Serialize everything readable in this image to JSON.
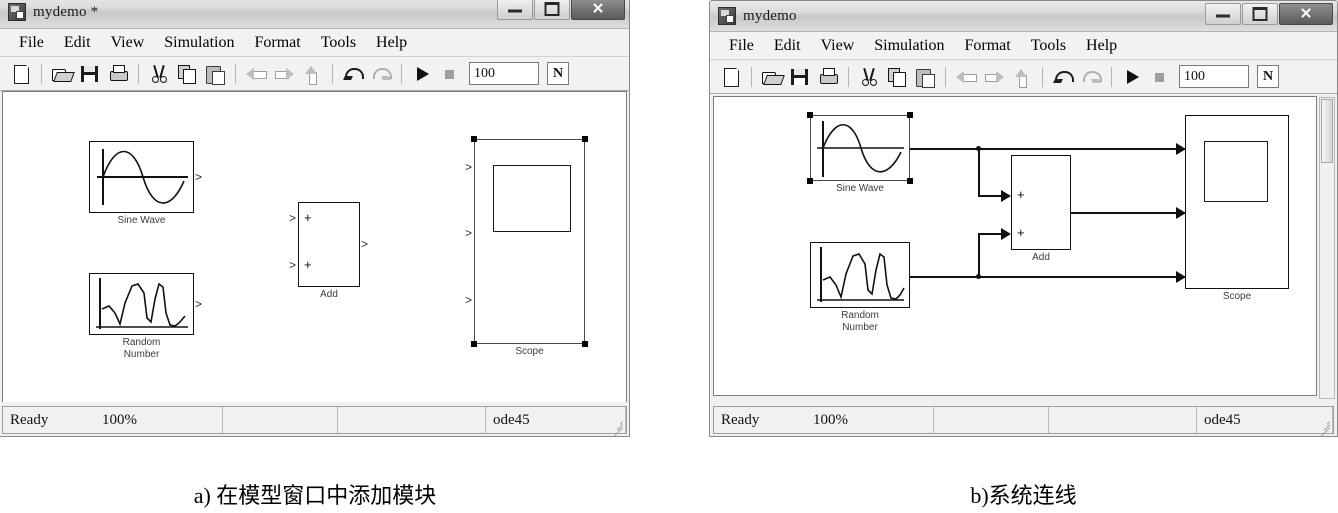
{
  "figure": {
    "caption_a": "a) 在模型窗口中添加模块",
    "caption_b": "b)系统连线"
  },
  "window_a": {
    "title": "mydemo *",
    "app_icon": "simulink-model-icon",
    "caption_buttons": {
      "minimize": "minimize-icon",
      "maximize": "maximize-icon",
      "close": "✕"
    },
    "menubar": [
      "File",
      "Edit",
      "View",
      "Simulation",
      "Format",
      "Tools",
      "Help"
    ],
    "toolbar": {
      "icons": [
        "new-model-icon",
        "open-model-icon",
        "save-icon",
        "print-icon",
        "cut-icon",
        "copy-icon",
        "paste-icon",
        "back-icon",
        "forward-icon",
        "up-level-icon",
        "undo-icon",
        "redo-icon",
        "start-simulation-icon",
        "stop-simulation-icon"
      ],
      "stop_time_value": "100",
      "sim_mode_value": "N"
    },
    "blocks": [
      {
        "name": "Sine Wave",
        "label": "Sine Wave",
        "type": "source-sine"
      },
      {
        "name": "Random Number",
        "label": "Random\nNumber",
        "type": "source-random"
      },
      {
        "name": "Add",
        "label": "Add",
        "type": "math-add",
        "signs": [
          "+",
          "+"
        ]
      },
      {
        "name": "Scope",
        "label": "Scope",
        "type": "sink-scope",
        "selected": true,
        "inputs": 3
      }
    ],
    "statusbar": {
      "state": "Ready",
      "zoom": "100%",
      "field3": "",
      "field4": "",
      "solver": "ode45"
    }
  },
  "window_b": {
    "title": "mydemo",
    "app_icon": "simulink-model-icon",
    "caption_buttons": {
      "minimize": "minimize-icon",
      "maximize": "maximize-icon",
      "close": "✕"
    },
    "menubar": [
      "File",
      "Edit",
      "View",
      "Simulation",
      "Format",
      "Tools",
      "Help"
    ],
    "toolbar": {
      "icons": [
        "new-model-icon",
        "open-model-icon",
        "save-icon",
        "print-icon",
        "cut-icon",
        "copy-icon",
        "paste-icon",
        "back-icon",
        "forward-icon",
        "up-level-icon",
        "undo-icon",
        "redo-icon",
        "start-simulation-icon",
        "stop-simulation-icon"
      ],
      "stop_time_value": "100",
      "sim_mode_value": "N"
    },
    "blocks": [
      {
        "name": "Sine Wave",
        "label": "Sine Wave",
        "type": "source-sine",
        "selected": true
      },
      {
        "name": "Random Number",
        "label": "Random\nNumber",
        "type": "source-random"
      },
      {
        "name": "Add",
        "label": "Add",
        "type": "math-add",
        "signs": [
          "+",
          "+"
        ]
      },
      {
        "name": "Scope",
        "label": "Scope",
        "type": "sink-scope",
        "inputs": 3
      }
    ],
    "connections": [
      {
        "from": "Sine Wave",
        "to": "Scope input 1"
      },
      {
        "from": "Sine Wave",
        "to": "Add input 1"
      },
      {
        "from": "Add",
        "to": "Scope input 2"
      },
      {
        "from": "Random Number",
        "to": "Add input 2"
      },
      {
        "from": "Random Number",
        "to": "Scope input 3"
      }
    ],
    "statusbar": {
      "state": "Ready",
      "zoom": "100%",
      "field3": "",
      "field4": "",
      "solver": "ode45"
    }
  },
  "colors": {
    "window_bg": "#f0f0f0",
    "canvas_bg": "#ffffff",
    "block_stroke": "#111111",
    "label_text": "#3d3d3d",
    "titlebar_gradient_top": "#e8e8e8",
    "titlebar_gradient_bottom": "#c8c8c8"
  }
}
